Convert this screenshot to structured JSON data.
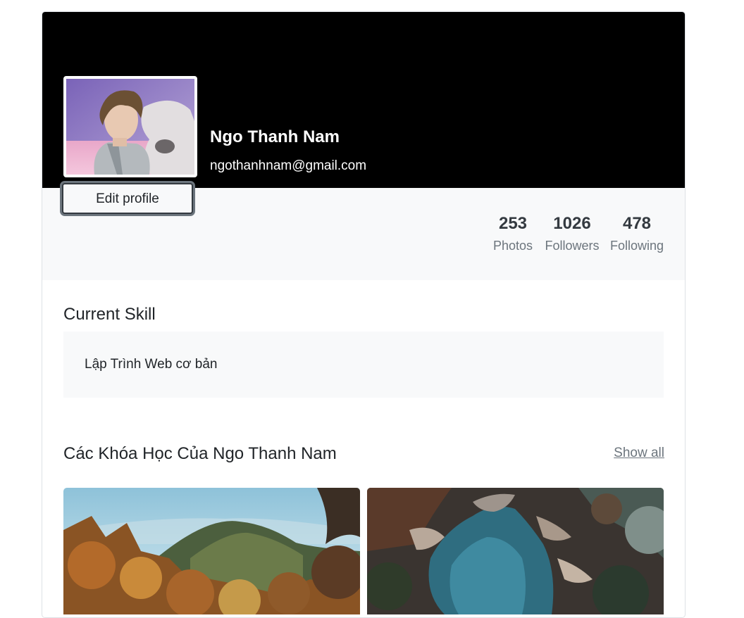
{
  "profile": {
    "name": "Ngo Thanh Nam",
    "email": "ngothanhnam@gmail.com",
    "edit_label": "Edit profile"
  },
  "stats": [
    {
      "value": "253",
      "label": "Photos"
    },
    {
      "value": "1026",
      "label": "Followers"
    },
    {
      "value": "478",
      "label": "Following"
    }
  ],
  "skill": {
    "title": "Current Skill",
    "text": "Lập Trình Web cơ bản"
  },
  "courses": {
    "title": "Các Khóa Học Của Ngo Thanh Nam",
    "show_all_label": "Show all",
    "images": [
      "mountain-autumn-forest-image",
      "river-canyon-forest-image"
    ]
  },
  "colors": {
    "cover": "#000000",
    "band": "#f8f9fa",
    "muted": "#6c757d",
    "text": "#212529"
  }
}
